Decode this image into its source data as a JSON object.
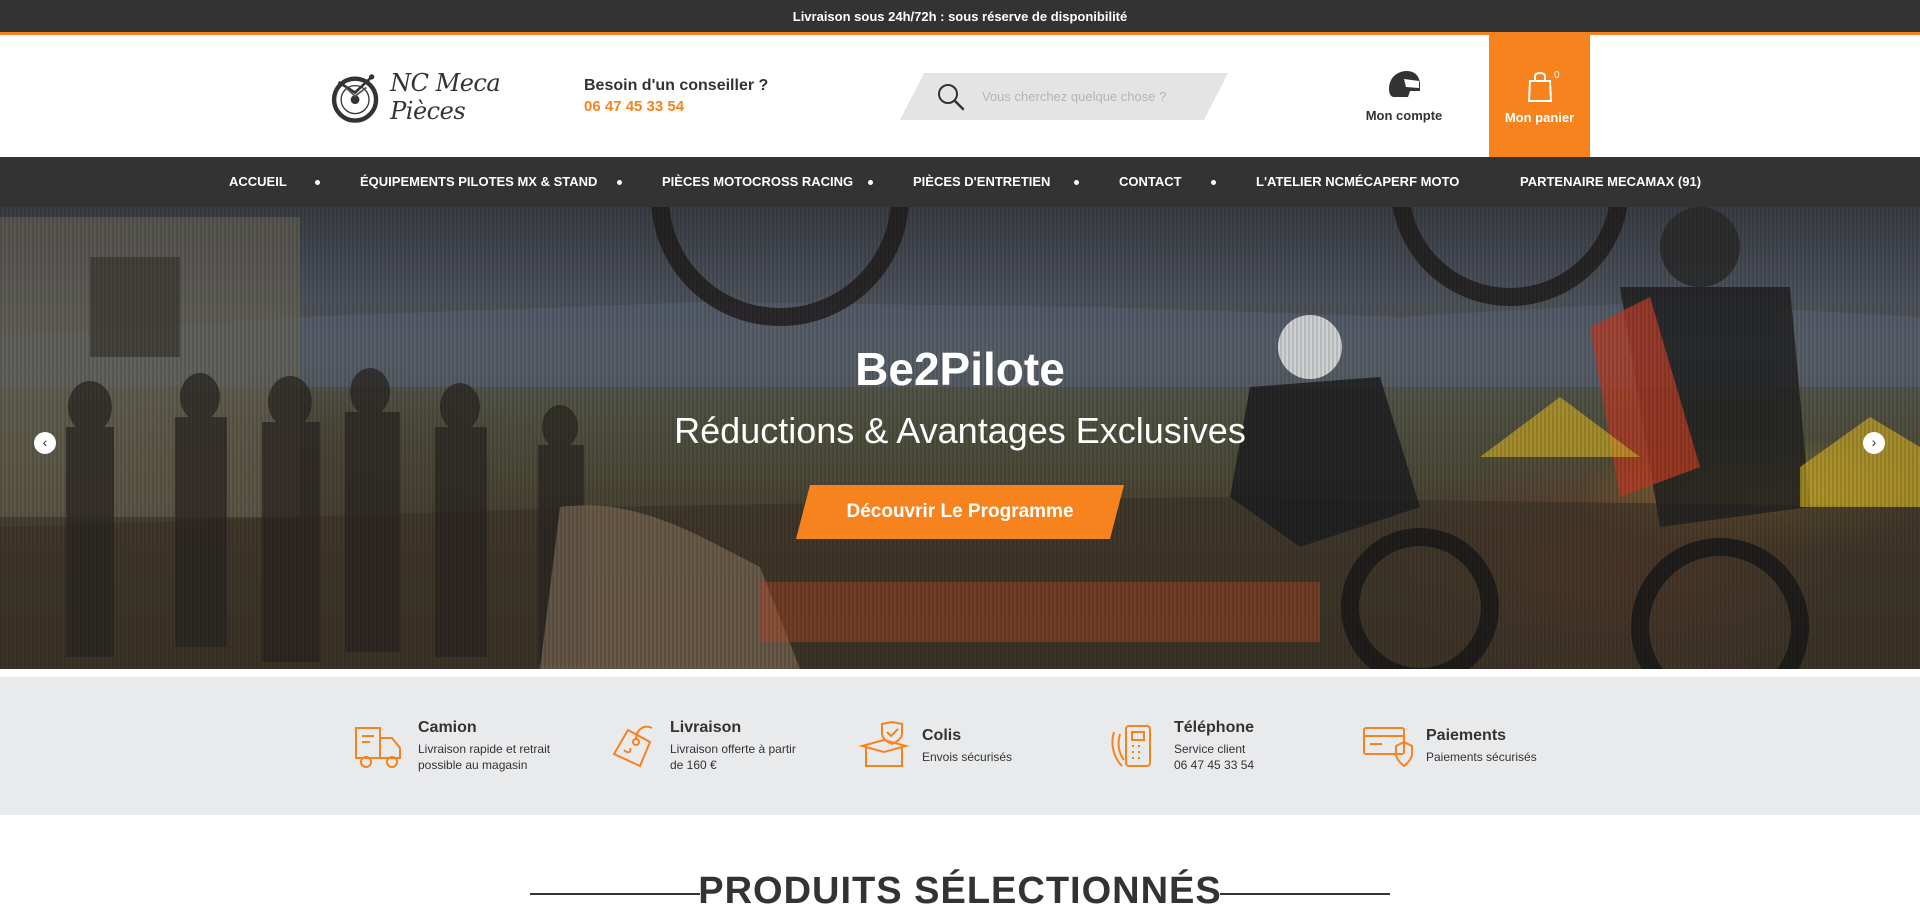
{
  "topbar": {
    "text": "Livraison sous 24h/72h : sous réserve de disponibilité"
  },
  "header": {
    "logo_text": "NC Meca Pièces",
    "advice_question": "Besoin d'un conseiller ?",
    "advice_phone": "06 47 45 33 54",
    "search_placeholder": "Vous cherchez quelque chose ?",
    "account_label": "Mon compte",
    "cart_label": "Mon panier",
    "cart_count": "0"
  },
  "nav": {
    "items": [
      {
        "label": "ACCUEIL"
      },
      {
        "label": "ÉQUIPEMENTS PILOTES MX & STAND"
      },
      {
        "label": "PIÈCES MOTOCROSS RACING"
      },
      {
        "label": "PIÈCES D'ENTRETIEN"
      },
      {
        "label": "CONTACT"
      },
      {
        "label": "L'ATELIER NCMÉCAPERF MOTO"
      },
      {
        "label": "PARTENAIRE MECAMAX (91)"
      }
    ]
  },
  "hero": {
    "title": "Be2Pilote",
    "subtitle": "Réductions & Avantages Exclusives",
    "button_label": "Découvrir Le Programme",
    "prev_label": "‹",
    "next_label": "›"
  },
  "features": [
    {
      "icon": "truck-icon",
      "title": "Camion",
      "desc_line1": "Livraison rapide et retrait",
      "desc_line2": "possible au magasin"
    },
    {
      "icon": "price-tag-icon",
      "title": "Livraison",
      "desc_line1": "Livraison offerte à partir",
      "desc_line2": "de 160 €"
    },
    {
      "icon": "package-check-icon",
      "title": "Colis",
      "desc_line1": "Envois sécurisés",
      "desc_line2": ""
    },
    {
      "icon": "phone-icon",
      "title": "Téléphone",
      "desc_line1": "Service client",
      "desc_line2": "06 47 45 33 54"
    },
    {
      "icon": "payment-card-icon",
      "title": "Paiements",
      "desc_line1": "Paiements sécurisés",
      "desc_line2": ""
    }
  ],
  "section": {
    "title": "PRODUITS SÉLECTIONNÉS"
  },
  "colors": {
    "accent": "#f7831f",
    "dark": "#333333",
    "feature_bg": "#e9eaec"
  }
}
